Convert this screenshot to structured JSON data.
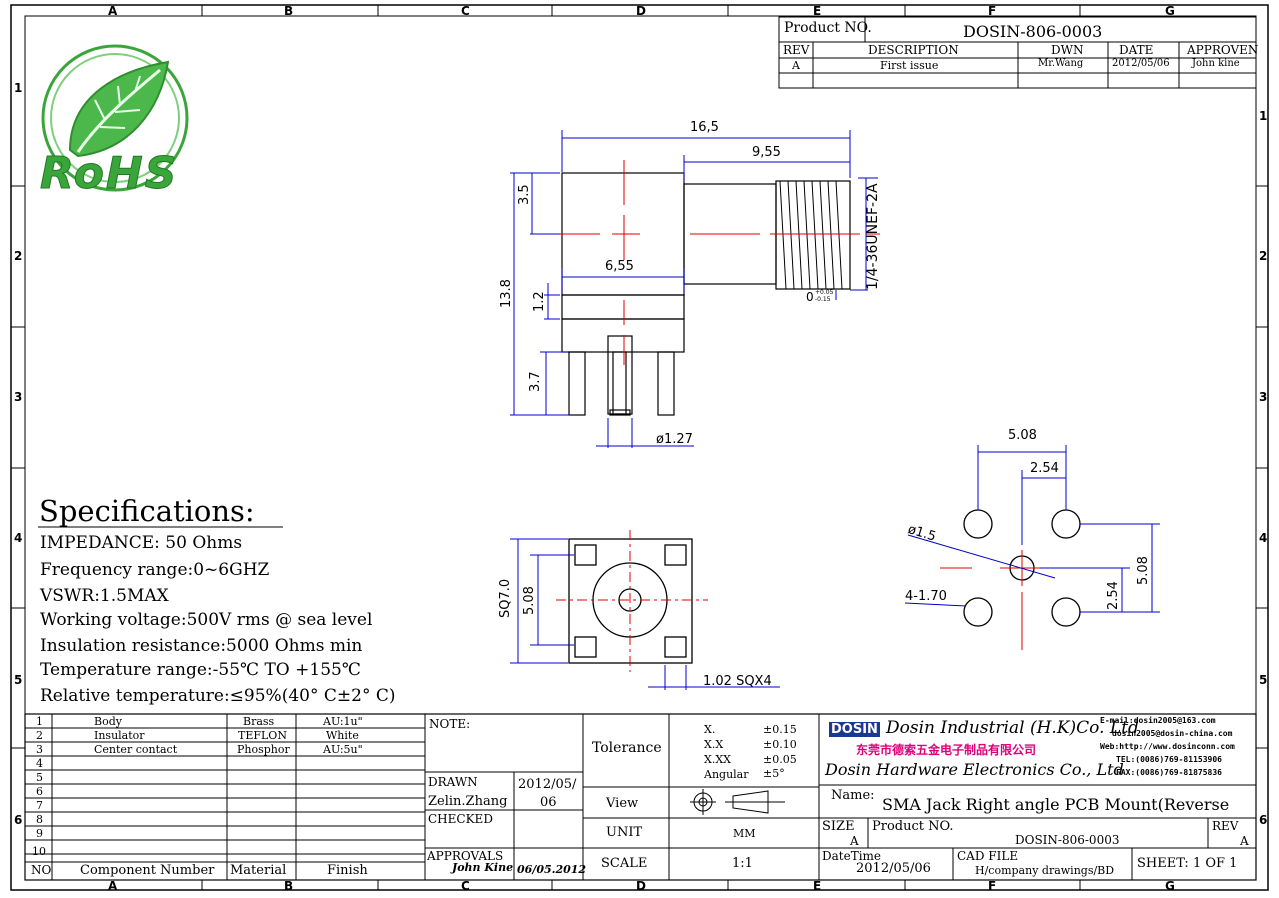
{
  "border": {
    "col_labels": [
      "A",
      "B",
      "C",
      "D",
      "E",
      "F",
      "G"
    ],
    "row_labels": [
      "1",
      "2",
      "3",
      "4",
      "5",
      "6"
    ]
  },
  "logo": {
    "text": "RoHS",
    "color": "#3aa53a"
  },
  "title_block_top": {
    "product_no_label": "Product NO.",
    "product_no": "DOSIN-806-0003",
    "headers": [
      "REV",
      "DESCRIPTION",
      "DWN",
      "DATE",
      "APPROVEN"
    ],
    "rows": [
      [
        "A",
        "First issue",
        "Mr.Wang",
        "2012/05/06",
        "John kine"
      ]
    ]
  },
  "dimensions": {
    "total_length": "16,5",
    "thread_length": "9,55",
    "body_width": "6,55",
    "top_height": "3.5",
    "total_height": "13.8",
    "flange_thickness": "1.2",
    "pin_length": "3.7",
    "pin_diameter": "ø1.27",
    "thread_spec": "1/4-36UNEF-2A",
    "tolerance_zero": "0",
    "tolerance_plus": "+0.05",
    "tolerance_minus": "-0.15",
    "square_size": "SQ7.0",
    "square_pitch": "5.08",
    "pad_size": "1.02 SQX4",
    "pcb_pitch": "5.08",
    "pcb_half_pitch": "2.54",
    "pcb_center_hole": "ø1.5",
    "pcb_ground_holes": "4-1.70",
    "pcb_pitch_v": "5.08",
    "pcb_half_pitch_v": "2.54"
  },
  "specifications": {
    "heading": "Specifications:",
    "lines": [
      "IMPEDANCE: 50 Ohms",
      "Frequency range:0~6GHZ",
      "VSWR:1.5MAX",
      "Working voltage:500V rms @ sea level",
      "Insulation resistance:5000 Ohms min",
      "Temperature range:-55℃ TO +155℃",
      "Relative temperature:≤95%(40° C±2° C)"
    ]
  },
  "bom": {
    "rows": [
      {
        "no": "1",
        "name": "Body",
        "material": "Brass",
        "finish": "AU:1u\""
      },
      {
        "no": "2",
        "name": "Insulator",
        "material": "TEFLON",
        "finish": "White"
      },
      {
        "no": "3",
        "name": "Center contact",
        "material": "Phosphor",
        "finish": "AU:5u\""
      },
      {
        "no": "4",
        "name": "",
        "material": "",
        "finish": ""
      },
      {
        "no": "5",
        "name": "",
        "material": "",
        "finish": ""
      },
      {
        "no": "6",
        "name": "",
        "material": "",
        "finish": ""
      },
      {
        "no": "7",
        "name": "",
        "material": "",
        "finish": ""
      },
      {
        "no": "8",
        "name": "",
        "material": "",
        "finish": ""
      },
      {
        "no": "9",
        "name": "",
        "material": "",
        "finish": ""
      },
      {
        "no": "10",
        "name": "",
        "material": "",
        "finish": ""
      }
    ],
    "footer": [
      "NO",
      "Component Number",
      "Material",
      "Finish"
    ]
  },
  "notes": {
    "note_label": "NOTE:",
    "drawn_label": "DRAWN",
    "drawn_by": "Zelin.Zhang",
    "drawn_date_a": "2012/05/",
    "drawn_date_b": "06",
    "checked_label": "CHECKED",
    "approvals_label": "APPROVALS",
    "approval_sign": "John Kine",
    "approval_date": "06/05.2012"
  },
  "tolerance": {
    "label": "Tolerance",
    "rows": [
      [
        "X.",
        "±0.15"
      ],
      [
        "X.X",
        "±0.10"
      ],
      [
        "X.XX",
        "±0.05"
      ],
      [
        "Angular",
        "±5°"
      ]
    ],
    "view_label": "View",
    "unit_label": "UNIT",
    "unit_value": "MM",
    "scale_label": "SCALE",
    "scale_value": "1:1"
  },
  "company": {
    "logo_text": "DOSIN",
    "name_en": "Dosin Industrial (H.K)Co. Ltd",
    "name_cn": "东莞市德索五金电子制品有限公司",
    "name_en2": "Dosin Hardware Electronics Co., Ltd",
    "email1": "E-mail:dosin2005@163.com",
    "email2": "dosin2005@dosin-china.com",
    "web": "Web:http://www.dosinconn.com",
    "tel": "TEL:(0086)769-81153906",
    "fax": "FAX:(0086)769-81875836",
    "accent": "#e0007a"
  },
  "title_block_bottom": {
    "name_label": "Name:",
    "name_value": "SMA Jack Right angle PCB Mount(Reverse",
    "size_label": "SIZE",
    "size_value": "A",
    "product_no_label": "Product NO.",
    "product_no": "DOSIN-806-0003",
    "rev_label": "REV",
    "rev_value": "A",
    "date_label": "DateTime",
    "date_value": "2012/05/06",
    "cad_label": "CAD FILE",
    "cad_value": "H/company drawings/BD",
    "sheet": "SHEET:  1 OF 1"
  }
}
